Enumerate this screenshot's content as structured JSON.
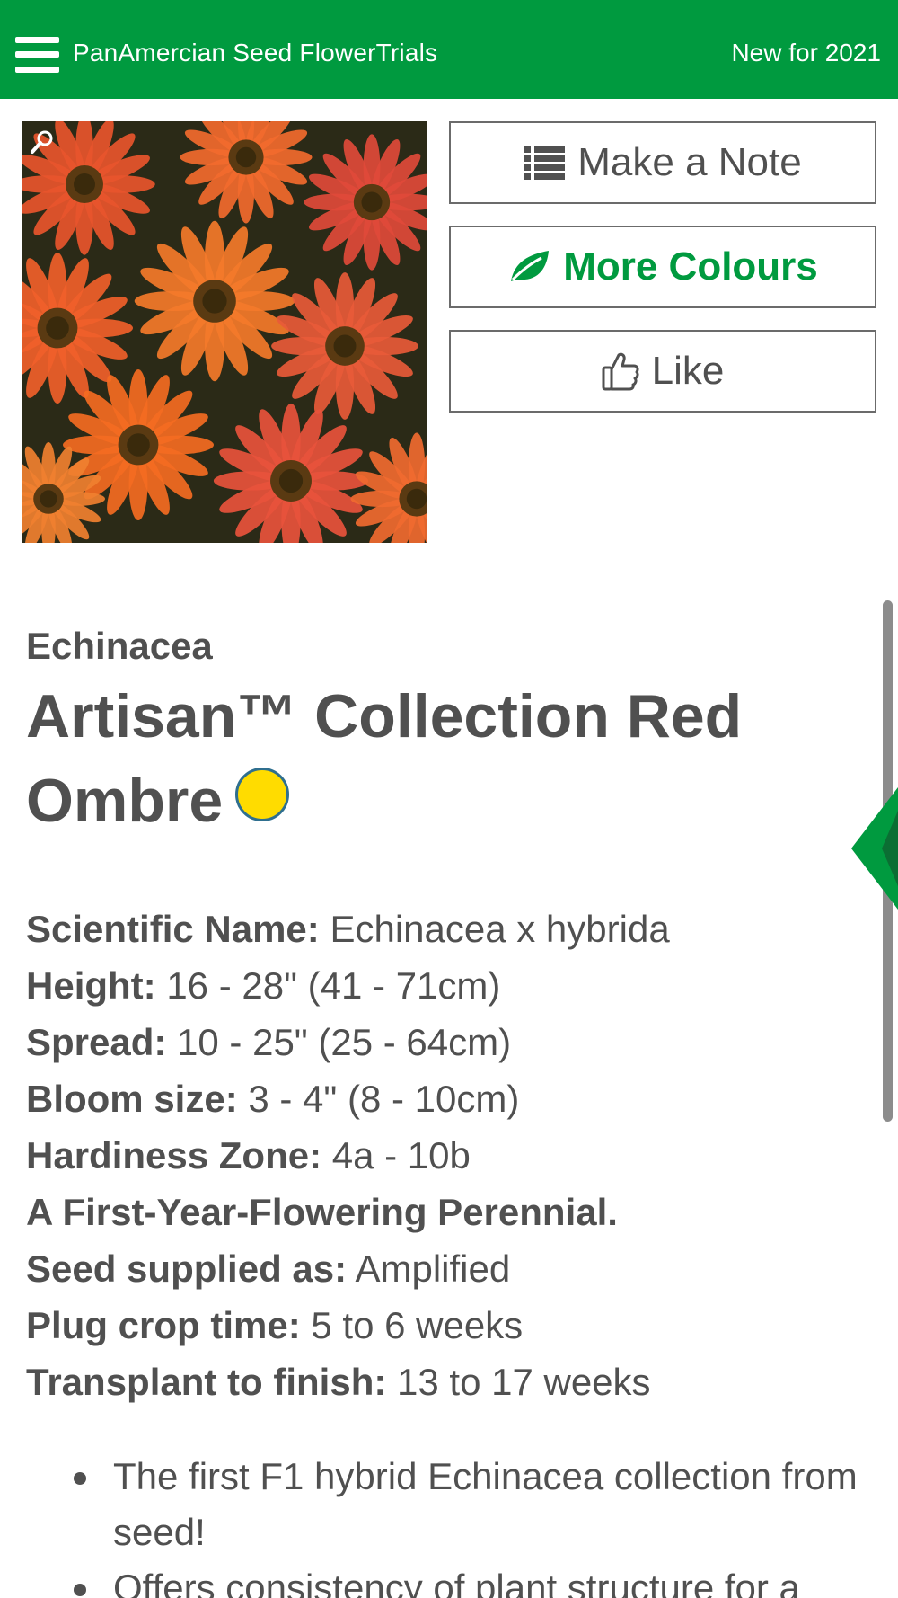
{
  "header": {
    "app_title": "PanAmercian Seed FlowerTrials",
    "season": "New for 2021",
    "menu_icon": "hamburger-menu-icon"
  },
  "photo": {
    "zoom_icon": "magnifier-icon"
  },
  "actions": {
    "note": {
      "label": "Make a Note",
      "icon": "list-icon"
    },
    "colours": {
      "label": "More Colours",
      "icon": "leaf-icon"
    },
    "like": {
      "label": "Like",
      "icon": "thumbs-up-icon"
    }
  },
  "product": {
    "genus": "Echinacea",
    "variety": "Artisan™ Collection Red Ombre",
    "badge_color": "#ffdc00"
  },
  "specs": [
    {
      "label": "Scientific Name:",
      "value": "Echinacea x hybrida"
    },
    {
      "label": "Height:",
      "value": "16 - 28\" (41 - 71cm)"
    },
    {
      "label": "Spread:",
      "value": "10 - 25\" (25 - 64cm)"
    },
    {
      "label": "Bloom size:",
      "value": "3 - 4\" (8 - 10cm)"
    },
    {
      "label": "Hardiness Zone:",
      "value": "4a - 10b"
    },
    {
      "label": "A First-Year-Flowering Perennial.",
      "value": ""
    },
    {
      "label": "Seed supplied as:",
      "value": "Amplified"
    },
    {
      "label": "Plug crop time:",
      "value": "5 to 6 weeks"
    },
    {
      "label": "Transplant to finish:",
      "value": "13 to 17 weeks"
    }
  ],
  "bullets": [
    "The first F1 hybrid Echinacea collection from seed!",
    "Offers consistency of plant structure for a"
  ],
  "colors": {
    "brand_green": "#009a3f",
    "text_gray": "#505050"
  }
}
